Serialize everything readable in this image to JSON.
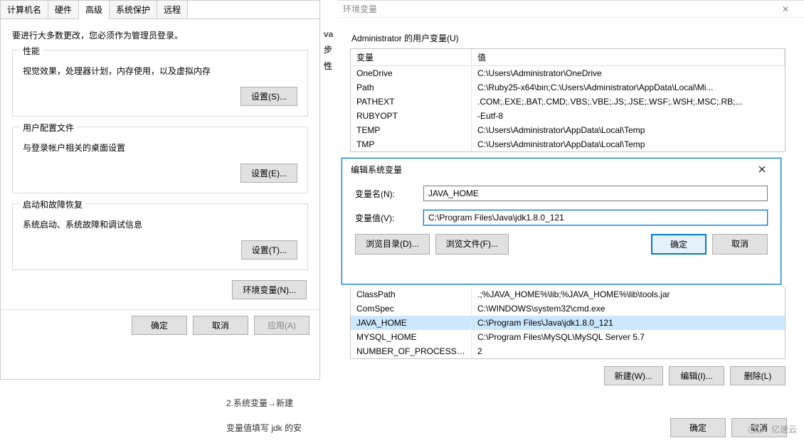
{
  "sysprops": {
    "tabs": [
      "计算机名",
      "硬件",
      "高级",
      "系统保护",
      "远程"
    ],
    "active_tab": 2,
    "admin_note": "要进行大多数更改，您必须作为管理员登录。",
    "perf": {
      "legend": "性能",
      "desc": "视觉效果，处理器计划，内存使用，以及虚拟内存",
      "btn": "设置(S)..."
    },
    "userprof": {
      "legend": "用户配置文件",
      "desc": "与登录帐户相关的桌面设置",
      "btn": "设置(E)..."
    },
    "startup": {
      "legend": "启动和故障恢复",
      "desc": "系统启动、系统故障和调试信息",
      "btn": "设置(T)..."
    },
    "envvars_btn": "环境变量(N)...",
    "ok": "确定",
    "cancel": "取消",
    "apply": "应用(A)"
  },
  "envvars": {
    "title": "环境变量",
    "user_section": "Administrator 的用户变量(U)",
    "col_name": "变量",
    "col_value": "值",
    "user_vars": [
      {
        "name": "OneDrive",
        "value": "C:\\Users\\Administrator\\OneDrive"
      },
      {
        "name": "Path",
        "value": "C:\\Ruby25-x64\\bin;C:\\Users\\Administrator\\AppData\\Local\\Mi..."
      },
      {
        "name": "PATHEXT",
        "value": ".COM;.EXE;.BAT;.CMD;.VBS;.VBE;.JS;.JSE;.WSF;.WSH;.MSC;.RB;..."
      },
      {
        "name": "RUBYOPT",
        "value": "-Eutf-8"
      },
      {
        "name": "TEMP",
        "value": "C:\\Users\\Administrator\\AppData\\Local\\Temp"
      },
      {
        "name": "TMP",
        "value": "C:\\Users\\Administrator\\AppData\\Local\\Temp"
      }
    ],
    "sys_vars": [
      {
        "name": "ClassPath",
        "value": ".;%JAVA_HOME%\\lib;%JAVA_HOME%\\lib\\tools.jar"
      },
      {
        "name": "ComSpec",
        "value": "C:\\WINDOWS\\system32\\cmd.exe"
      },
      {
        "name": "JAVA_HOME",
        "value": "C:\\Program Files\\Java\\jdk1.8.0_121",
        "selected": true
      },
      {
        "name": "MYSQL_HOME",
        "value": "C:\\Program Files\\MySQL\\MySQL Server 5.7"
      },
      {
        "name": "NUMBER_OF_PROCESSORS",
        "value": "2"
      }
    ],
    "new_btn": "新建(W)...",
    "edit_btn": "编辑(I)...",
    "del_btn": "删除(L)",
    "ok": "确定",
    "cancel": "取消"
  },
  "editvar": {
    "title": "编辑系统变量",
    "name_label": "变量名(N):",
    "value_label": "变量值(V):",
    "name": "JAVA_HOME",
    "value": "C:\\Program Files\\Java\\jdk1.8.0_121",
    "browse_dir": "浏览目录(D)...",
    "browse_file": "浏览文件(F)...",
    "ok": "确定",
    "cancel": "取消"
  },
  "article": {
    "line1": "2.系统变量→新建",
    "line2": "变量值填写 jdk 的安"
  },
  "side_blur": [
    "va",
    "步",
    "性"
  ],
  "logo_text": "亿速云"
}
